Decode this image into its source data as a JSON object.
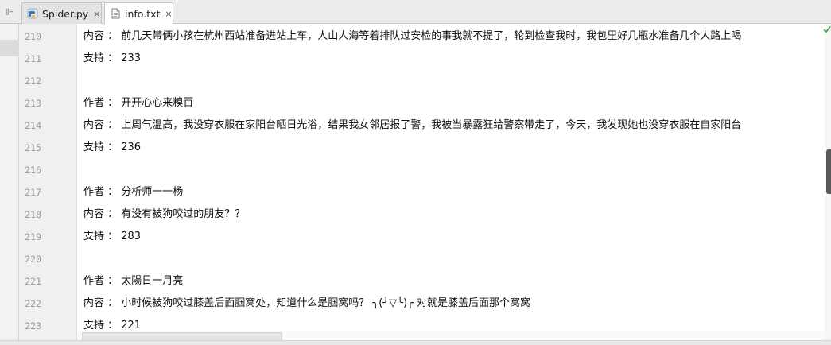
{
  "tabs": [
    {
      "label": "Spider.py",
      "icon": "python-file-icon",
      "active": false
    },
    {
      "label": "info.txt",
      "icon": "text-file-icon",
      "active": true
    }
  ],
  "close_glyph": "×",
  "gutter_button_glyph": "⊪",
  "editor_lines": [
    {
      "number": "210",
      "text": "内容 ： 前几天带俩小孩在杭州西站准备进站上车，人山人海等着排队过安检的事我就不提了，轮到检查我时，我包里好几瓶水准备几个人路上喝"
    },
    {
      "number": "211",
      "text": "支持 ： 233"
    },
    {
      "number": "212",
      "text": ""
    },
    {
      "number": "213",
      "text": "作者 ： 开开心心来糗百"
    },
    {
      "number": "214",
      "text": "内容 ： 上周气温高，我没穿衣服在家阳台晒日光浴，结果我女邻居报了警，我被当暴露狂给警察带走了，今天，我发现她也没穿衣服在自家阳台"
    },
    {
      "number": "215",
      "text": "支持 ： 236"
    },
    {
      "number": "216",
      "text": ""
    },
    {
      "number": "217",
      "text": "作者 ： 分析师一一杨"
    },
    {
      "number": "218",
      "text": "内容 ： 有没有被狗咬过的朋友？？"
    },
    {
      "number": "219",
      "text": "支持 ： 283"
    },
    {
      "number": "220",
      "text": ""
    },
    {
      "number": "221",
      "text": "作者 ： 太陽日一月亮"
    },
    {
      "number": "222",
      "text": "内容 ： 小时候被狗咬过膝盖后面腘窝处，知道什么是腘窝吗？ ╮(╯▽╰)╭ 对就是膝盖后面那个窝窝"
    },
    {
      "number": "223",
      "text": "支持 ： 221"
    }
  ],
  "colors": {
    "accent_ok": "#3ea84a",
    "line_number": "#999999",
    "text": "#111111"
  }
}
